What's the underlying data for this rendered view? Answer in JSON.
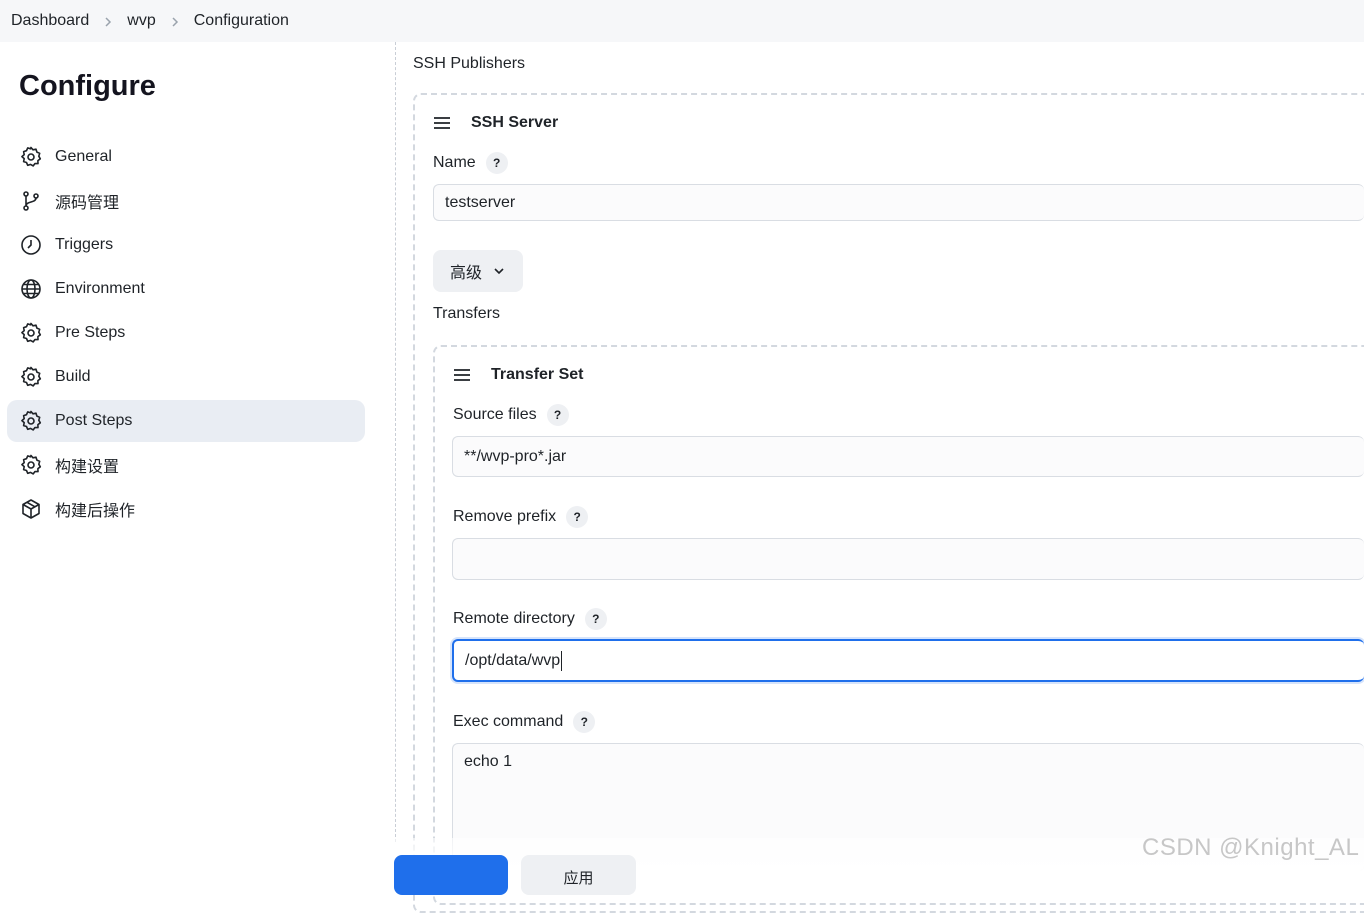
{
  "breadcrumb": {
    "items": [
      "Dashboard",
      "wvp",
      "Configuration"
    ]
  },
  "sidebar": {
    "title": "Configure",
    "items": [
      {
        "label": "General",
        "icon": "gear-icon"
      },
      {
        "label": "源码管理",
        "icon": "branch-icon"
      },
      {
        "label": "Triggers",
        "icon": "clock-icon"
      },
      {
        "label": "Environment",
        "icon": "globe-icon"
      },
      {
        "label": "Pre Steps",
        "icon": "gear-icon"
      },
      {
        "label": "Build",
        "icon": "gear-icon"
      },
      {
        "label": "Post Steps",
        "icon": "gear-icon",
        "active": true
      },
      {
        "label": "构建设置",
        "icon": "gear-icon"
      },
      {
        "label": "构建后操作",
        "icon": "package-icon"
      }
    ]
  },
  "main": {
    "section_title": "SSH Publishers",
    "server": {
      "title": "SSH Server",
      "name_label": "Name",
      "name_value": "testserver",
      "advanced_label": "高级",
      "transfers_label": "Transfers"
    },
    "transfer_set": {
      "title": "Transfer Set",
      "source_files_label": "Source files",
      "source_files_value": "**/wvp-pro*.jar",
      "remove_prefix_label": "Remove prefix",
      "remove_prefix_value": "",
      "remote_directory_label": "Remote directory",
      "remote_directory_value": "/opt/data/wvp",
      "exec_command_label": "Exec command",
      "exec_command_value": "echo 1"
    },
    "help_mark": "?"
  },
  "footer": {
    "apply_label": "应用",
    "watermark": "CSDN @Knight_AL"
  },
  "colors": {
    "accent": "#1f6feb",
    "active_nav_bg": "#e9edf3"
  }
}
